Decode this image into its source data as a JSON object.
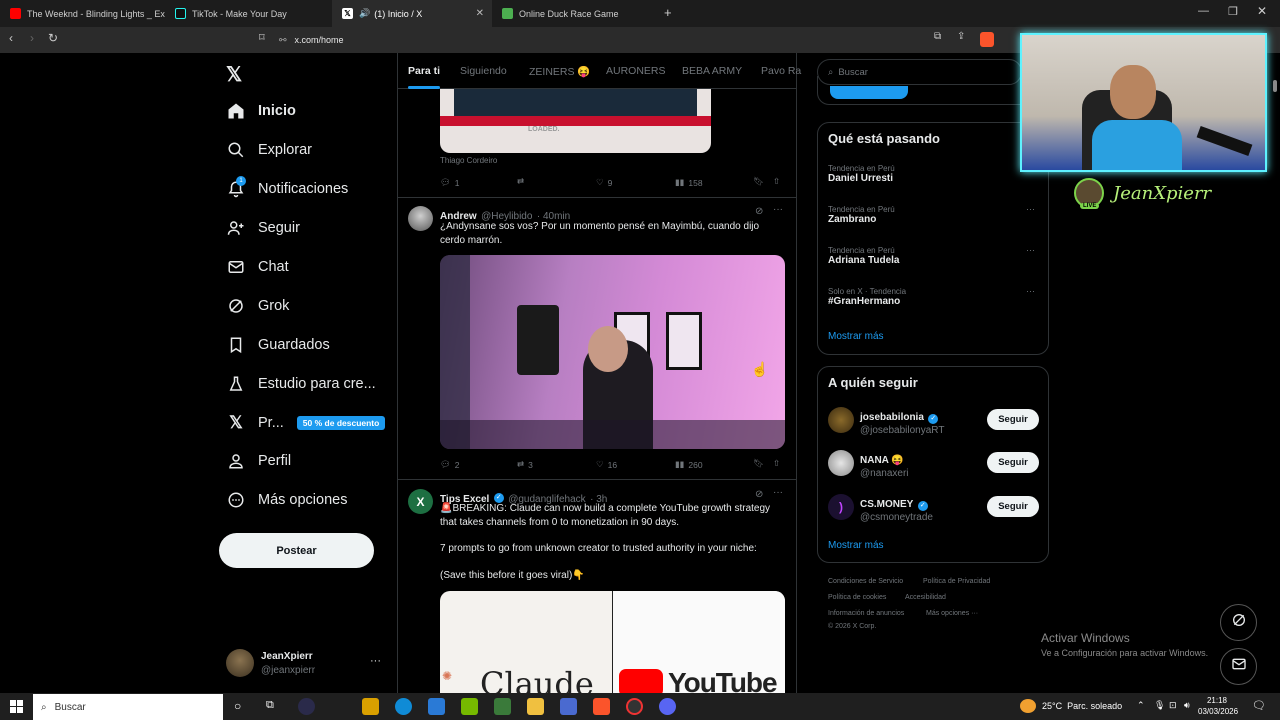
{
  "browser": {
    "tabs": [
      {
        "title": "The Weeknd - Blinding Lights _ Exte",
        "icon": "youtube-icon",
        "color": "#ff0000"
      },
      {
        "title": "TikTok - Make Your Day",
        "icon": "tiktok-icon",
        "color": "#ffffff"
      },
      {
        "title": "(1) Inicio / X",
        "icon": "x-icon",
        "color": "#ffffff",
        "active": true
      },
      {
        "title": "Online Duck Race Game",
        "icon": "duck-icon",
        "color": "#4caf50"
      }
    ],
    "url": "x.com/home"
  },
  "sidebar": {
    "items": [
      {
        "label": "Inicio",
        "icon": "home-icon"
      },
      {
        "label": "Explorar",
        "icon": "search-icon"
      },
      {
        "label": "Notificaciones",
        "icon": "bell-icon",
        "badge": "1"
      },
      {
        "label": "Seguir",
        "icon": "person-add-icon"
      },
      {
        "label": "Chat",
        "icon": "mail-icon"
      },
      {
        "label": "Grok",
        "icon": "grok-icon"
      },
      {
        "label": "Guardados",
        "icon": "bookmark-icon"
      },
      {
        "label": "Estudio para cre...",
        "icon": "flask-icon"
      },
      {
        "label": "Pr...",
        "icon": "x-logo-icon",
        "badge_text": "50 % de descuento"
      },
      {
        "label": "Perfil",
        "icon": "person-icon"
      },
      {
        "label": "Más opciones",
        "icon": "more-circle-icon"
      }
    ],
    "post_button": "Postear",
    "account": {
      "name": "JeanXpierr",
      "handle": "@jeanxpierr"
    }
  },
  "feed": {
    "tabs": [
      "Para ti",
      "Siguiendo",
      "ZEINERS 😝",
      "AURONERS",
      "BEBA ARMY",
      "Pavo Ra"
    ],
    "tweet0": {
      "image_text": "LOADED.",
      "credit": "Thiago Cordeiro",
      "replies": "1",
      "reposts": "",
      "likes": "9",
      "views": "158"
    },
    "tweet1": {
      "name": "Andrew",
      "handle": "@Heylibido",
      "time": "· 40min",
      "text": "¿Andynsane sos vos? Por un momento pensé en Mayimbú, cuando dijo cerdo marrón.",
      "replies": "2",
      "reposts": "3",
      "likes": "16",
      "views": "260"
    },
    "tweet2": {
      "name": "Tips Excel",
      "handle": "@gudanglifehack",
      "time": "· 3h",
      "line1": "🚨BREAKING: Claude can now build a complete YouTube growth strategy that takes channels from 0 to monetization in 90 days.",
      "line2": "7 prompts to go from unknown creator to trusted authority in your niche:",
      "line3": "(Save this before it goes viral)👇",
      "img_left": "Claude",
      "img_right": "YouTube"
    }
  },
  "right": {
    "search_placeholder": "Buscar",
    "trending_title": "Qué está pasando",
    "trends": [
      {
        "context": "Tendencia en Perú",
        "name": "Daniel Urresti"
      },
      {
        "context": "Tendencia en Perú",
        "name": "Zambrano"
      },
      {
        "context": "Tendencia en Perú",
        "name": "Adriana Tudela"
      },
      {
        "context": "Solo en X · Tendencia",
        "name": "#GranHermano"
      }
    ],
    "show_more": "Mostrar más",
    "follow_title": "A quién seguir",
    "follow": [
      {
        "name": "josebabilonia",
        "handle": "@josebabilonyaRT",
        "verified": true
      },
      {
        "name": "NANA 😝",
        "handle": "@nanaxeri",
        "verified": false
      },
      {
        "name": "CS.MONEY",
        "handle": "@csmoneytrade",
        "verified": true
      }
    ],
    "follow_btn": "Seguir",
    "footer": [
      "Condiciones de Servicio",
      "Política de Privacidad",
      "Política de cookies",
      "Accesibilidad",
      "Información de anuncios",
      "Más opciones ···",
      "© 2026 X Corp."
    ]
  },
  "overlay": {
    "streamer_name": "JeanXpierr",
    "live_label": "LIVE",
    "activate_title": "Activar Windows",
    "activate_sub": "Ve a Configuración para activar Windows."
  },
  "taskbar": {
    "search": "Buscar",
    "weather": "25°C  Parc. soleado",
    "time": "21:18",
    "date": "03/03/2026"
  }
}
